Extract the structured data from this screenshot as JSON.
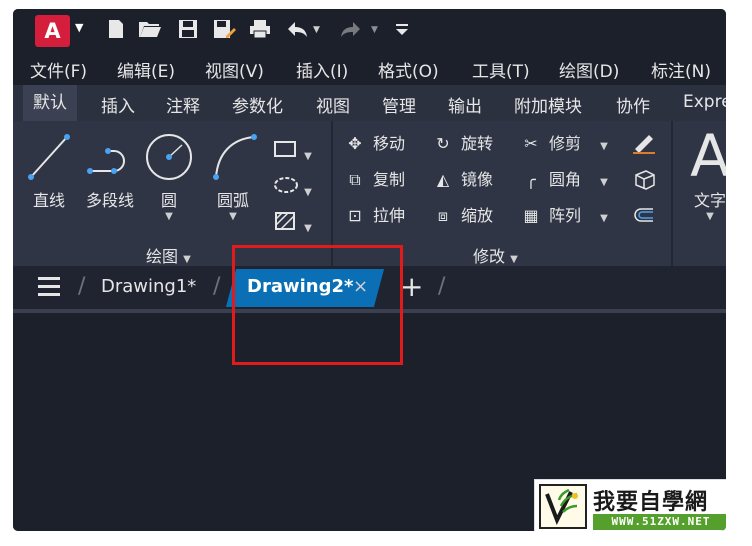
{
  "app": {
    "logo_letter": "A"
  },
  "menu": [
    "文件(F)",
    "编辑(E)",
    "视图(V)",
    "插入(I)",
    "格式(O)",
    "工具(T)",
    "绘图(D)",
    "标注(N)"
  ],
  "ribbon_tabs": [
    "默认",
    "插入",
    "注释",
    "参数化",
    "视图",
    "管理",
    "输出",
    "附加模块",
    "协作",
    "Expre"
  ],
  "draw_panel": {
    "label": "绘图",
    "tools": {
      "line": "直线",
      "polyline": "多段线",
      "circle": "圆",
      "arc": "圆弧"
    }
  },
  "modify_panel": {
    "label": "修改",
    "tools": {
      "move": "移动",
      "rotate": "旋转",
      "trim": "修剪",
      "copy": "复制",
      "mirror": "镜像",
      "fillet": "圆角",
      "stretch": "拉伸",
      "scale": "缩放",
      "array": "阵列"
    }
  },
  "annotation_panel": {
    "text_glyph": "A",
    "text_label": "文字"
  },
  "file_tabs": {
    "tab1": "Drawing1*",
    "tab2": "Drawing2*",
    "close": "×",
    "new": "+"
  },
  "watermark": {
    "title": "我要自學網",
    "url": "WWW.51ZXW.NET"
  },
  "colors": {
    "active_tab": "#0a6fb5",
    "highlight": "#e01b1b",
    "logo": "#d41e3c"
  }
}
